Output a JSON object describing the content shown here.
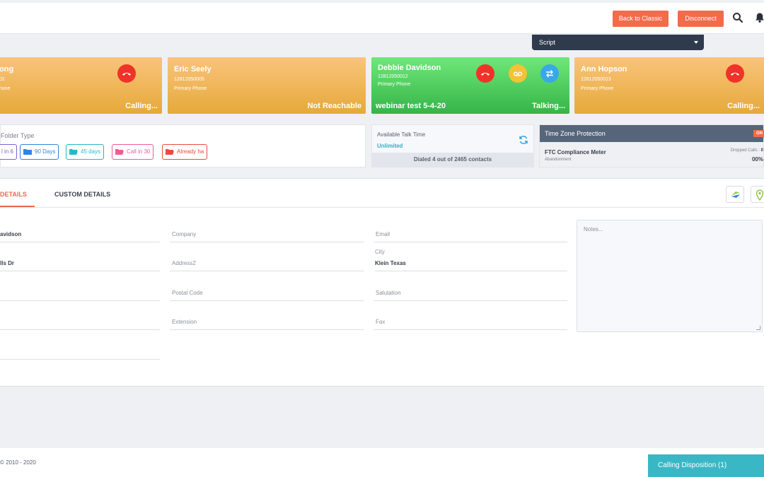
{
  "topbar": {
    "back_label": "Back to Classic",
    "disconnect_label": "Disconnect"
  },
  "script": {
    "label": "Script"
  },
  "cards": [
    {
      "name": "ong",
      "phone": "01",
      "type": "hone",
      "status": "Calling...",
      "color": "#eaac42"
    },
    {
      "name": "Eric Seely",
      "phone": "12812050005",
      "type": "Primary Phone",
      "status": "Not Reachable",
      "color": "#eaac42"
    },
    {
      "name": "Debbie Davidson",
      "phone": "12812050012",
      "type": "Primary Phone",
      "status": "Talking...",
      "campaign": "webinar test 5-4-20",
      "color": "#3fbd4f"
    },
    {
      "name": "Ann Hopson",
      "phone": "12812050013",
      "type": "Primary Phone",
      "status": "Calling...",
      "color": "#eaac42"
    }
  ],
  "folders": {
    "title": "Folder Type",
    "chips": [
      {
        "label": "l in 6",
        "color": "#7b63d3"
      },
      {
        "label": "90 Days",
        "color": "#2f84e3"
      },
      {
        "label": "45 days",
        "color": "#27b8c5"
      },
      {
        "label": "Call in 30",
        "color": "#ee5b92"
      },
      {
        "label": "Already ha",
        "color": "#e84c3d"
      }
    ]
  },
  "talk": {
    "label": "Available Talk Time",
    "value": "Unlimited",
    "dialed": "Dialed 4 out of 2465 contacts"
  },
  "timezone": {
    "title": "Time Zone Protection",
    "badge": "ON",
    "meter_title": "FTC Compliance Meter",
    "meter_sub": "Abandonment",
    "dropped_label": "Dropped Calls :",
    "dropped_value": "0",
    "percent": "00%"
  },
  "details": {
    "tabs": {
      "details": "DETAILS",
      "custom": "CUSTOM DETAILS"
    },
    "col1": {
      "name": "avidson",
      "address": "lls Dr"
    },
    "col2": {
      "company": "Company",
      "address2": "Address2",
      "postal": "Postal Code",
      "extension": "Extension"
    },
    "col3": {
      "email": "Email",
      "city_label": "City",
      "city_value": "Klein Texas",
      "salutation": "Salutation",
      "fax": "Fax"
    },
    "notes_placeholder": "Notes..."
  },
  "footer": {
    "copyright": "© 2010 - 2020",
    "disposition": "Calling Disposition (1)"
  }
}
